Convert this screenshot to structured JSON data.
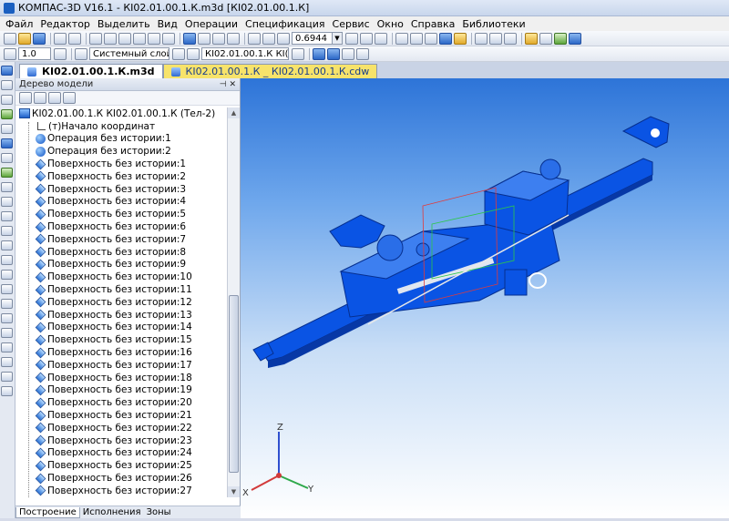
{
  "window": {
    "title": "КОМПАС-3D V16.1 - КІ02.01.00.1.К.m3d [КІ02.01.00.1.К]"
  },
  "menu": [
    "Файл",
    "Редактор",
    "Выделить",
    "Вид",
    "Операции",
    "Спецификация",
    "Сервис",
    "Окно",
    "Справка",
    "Библиотеки"
  ],
  "toolbar": {
    "zoom_value": "0.6944",
    "step_value": "1.0",
    "layer_value": "Системный слой",
    "part_value": "КІ02.01.00.1.К КІ("
  },
  "tabs": [
    {
      "label": "КІ02.01.00.1.К.m3d",
      "active": true
    },
    {
      "label": "КІ02.01.00.1.К _ КІ02.01.00.1.К.cdw",
      "active": false
    }
  ],
  "panel": {
    "title": "Дерево модели",
    "root": "КІ02.01.00.1.К КІ02.01.00.1.К (Тел-2)",
    "items": [
      {
        "label": "(т)Начало координат",
        "icon": "coordinate-origin-icon"
      },
      {
        "label": "Операция без истории:1",
        "icon": "operation-icon"
      },
      {
        "label": "Операция без истории:2",
        "icon": "operation-icon"
      },
      {
        "label": "Поверхность без истории:1",
        "icon": "surface-icon"
      },
      {
        "label": "Поверхность без истории:2",
        "icon": "surface-icon"
      },
      {
        "label": "Поверхность без истории:3",
        "icon": "surface-icon"
      },
      {
        "label": "Поверхность без истории:4",
        "icon": "surface-icon"
      },
      {
        "label": "Поверхность без истории:5",
        "icon": "surface-icon"
      },
      {
        "label": "Поверхность без истории:6",
        "icon": "surface-icon"
      },
      {
        "label": "Поверхность без истории:7",
        "icon": "surface-icon"
      },
      {
        "label": "Поверхность без истории:8",
        "icon": "surface-icon"
      },
      {
        "label": "Поверхность без истории:9",
        "icon": "surface-icon"
      },
      {
        "label": "Поверхность без истории:10",
        "icon": "surface-icon"
      },
      {
        "label": "Поверхность без истории:11",
        "icon": "surface-icon"
      },
      {
        "label": "Поверхность без истории:12",
        "icon": "surface-icon"
      },
      {
        "label": "Поверхность без истории:13",
        "icon": "surface-icon"
      },
      {
        "label": "Поверхность без истории:14",
        "icon": "surface-icon"
      },
      {
        "label": "Поверхность без истории:15",
        "icon": "surface-icon"
      },
      {
        "label": "Поверхность без истории:16",
        "icon": "surface-icon"
      },
      {
        "label": "Поверхность без истории:17",
        "icon": "surface-icon"
      },
      {
        "label": "Поверхность без истории:18",
        "icon": "surface-icon"
      },
      {
        "label": "Поверхность без истории:19",
        "icon": "surface-icon"
      },
      {
        "label": "Поверхность без истории:20",
        "icon": "surface-icon"
      },
      {
        "label": "Поверхность без истории:21",
        "icon": "surface-icon"
      },
      {
        "label": "Поверхность без истории:22",
        "icon": "surface-icon"
      },
      {
        "label": "Поверхность без истории:23",
        "icon": "surface-icon"
      },
      {
        "label": "Поверхность без истории:24",
        "icon": "surface-icon"
      },
      {
        "label": "Поверхность без истории:25",
        "icon": "surface-icon"
      },
      {
        "label": "Поверхность без истории:26",
        "icon": "surface-icon"
      },
      {
        "label": "Поверхность без истории:27",
        "icon": "surface-icon"
      }
    ],
    "bottom_tabs": [
      "Построение",
      "Исполнения",
      "Зоны"
    ]
  },
  "axes": {
    "x": "X",
    "y": "Y",
    "z": "Z"
  },
  "colors": {
    "model": "#0a54e4",
    "viewport_top": "#2d74d8",
    "active_tab_other": "#f7e36a"
  }
}
